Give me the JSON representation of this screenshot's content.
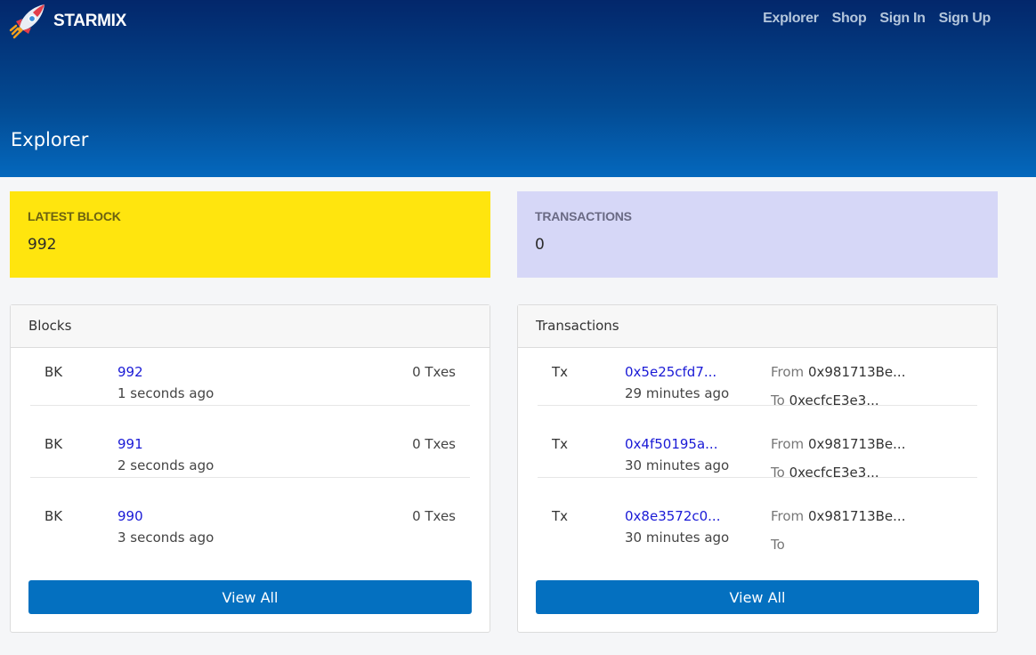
{
  "header": {
    "brand": "STARMIX",
    "nav": [
      "Explorer",
      "Shop",
      "Sign In",
      "Sign Up"
    ],
    "page_title": "Explorer"
  },
  "stats": {
    "latest_block": {
      "label": "LATEST BLOCK",
      "value": "992"
    },
    "transactions": {
      "label": "TRANSACTIONS",
      "value": "0"
    }
  },
  "blocks": {
    "title": "Blocks",
    "rows": [
      {
        "type": "BK",
        "number": "992",
        "time": "1 seconds ago",
        "txes": "0 Txes"
      },
      {
        "type": "BK",
        "number": "991",
        "time": "2 seconds ago",
        "txes": "0 Txes"
      },
      {
        "type": "BK",
        "number": "990",
        "time": "3 seconds ago",
        "txes": "0 Txes"
      }
    ],
    "view_all": "View All"
  },
  "transactions": {
    "title": "Transactions",
    "rows": [
      {
        "type": "Tx",
        "hash": "0x5e25cfd7...",
        "time": "29 minutes ago",
        "from_label": "From",
        "from": "0x981713Be...",
        "to_label": "To",
        "to": "0xecfcE3e3..."
      },
      {
        "type": "Tx",
        "hash": "0x4f50195a...",
        "time": "30 minutes ago",
        "from_label": "From",
        "from": "0x981713Be...",
        "to_label": "To",
        "to": "0xecfcE3e3..."
      },
      {
        "type": "Tx",
        "hash": "0x8e3572c0...",
        "time": "30 minutes ago",
        "from_label": "From",
        "from": "0x981713Be...",
        "to_label": "To",
        "to": ""
      }
    ],
    "view_all": "View All"
  },
  "colors": {
    "latest_block_bg": "#ffe50e",
    "transactions_bg": "#d6d7f7",
    "button": "#0470c0",
    "link": "#1a1ad6"
  },
  "icons": {
    "logo": "rocket-icon"
  }
}
